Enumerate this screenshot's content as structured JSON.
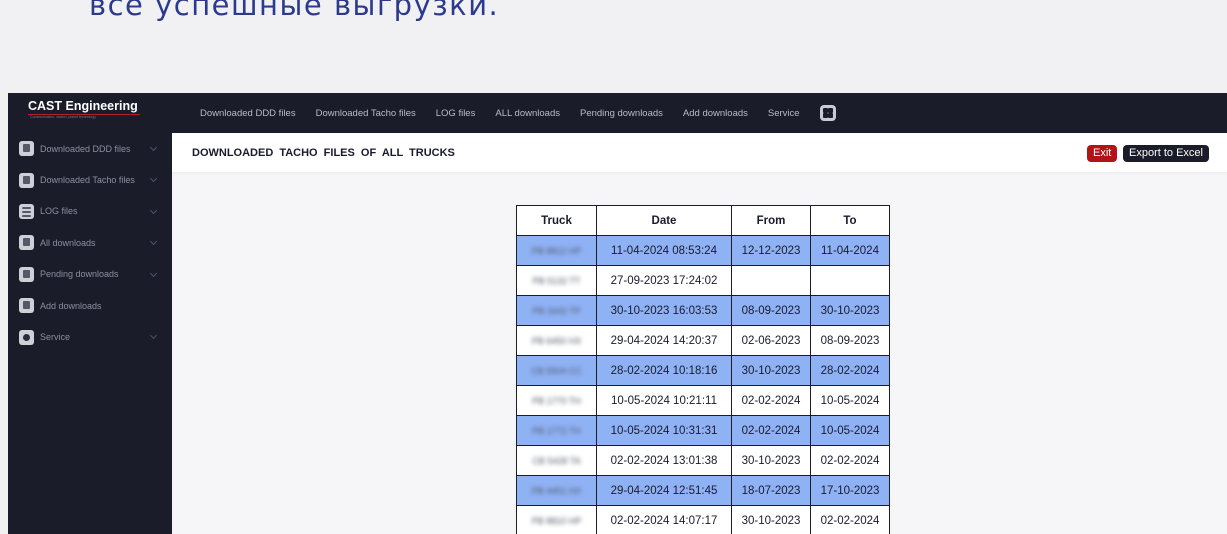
{
  "caption": "все успешные выгрузки.",
  "brand": {
    "title": "CAST Engineering",
    "subtitle": "Communication, station, planet technology"
  },
  "topnav": [
    "Downloaded DDD files",
    "Downloaded Tacho files",
    "LOG files",
    "ALL downloads",
    "Pending downloads",
    "Add downloads",
    "Service"
  ],
  "sidebar": [
    {
      "label": "Downloaded DDD files",
      "icon": "file-icon",
      "expandable": true
    },
    {
      "label": "Downloaded Tacho files",
      "icon": "file-icon",
      "expandable": true
    },
    {
      "label": "LOG files",
      "icon": "list-icon",
      "expandable": true
    },
    {
      "label": "All downloads",
      "icon": "file-icon",
      "expandable": true
    },
    {
      "label": "Pending downloads",
      "icon": "file-icon",
      "expandable": true
    },
    {
      "label": "Add downloads",
      "icon": "file-icon",
      "expandable": false
    },
    {
      "label": "Service",
      "icon": "gear-icon",
      "expandable": true
    }
  ],
  "page_title": "DOWNLOADED TACHO FILES OF ALL TRUCKS",
  "buttons": {
    "exit": "Exit",
    "export": "Export to Excel"
  },
  "table": {
    "headers": [
      "Truck",
      "Date",
      "From",
      "To"
    ],
    "rows": [
      {
        "truck": "PB 8812 HP",
        "date": "11-04-2024 08:53:24",
        "from": "12-12-2023",
        "to": "11-04-2024",
        "highlight": true
      },
      {
        "truck": "PB 5132 TT",
        "date": "27-09-2023 17:24:02",
        "from": "",
        "to": "",
        "highlight": false
      },
      {
        "truck": "PB 1642 TP",
        "date": "30-10-2023 16:03:53",
        "from": "08-09-2023",
        "to": "30-10-2023",
        "highlight": true
      },
      {
        "truck": "PB 6450 HX",
        "date": "29-04-2024 14:20:37",
        "from": "02-06-2023",
        "to": "08-09-2023",
        "highlight": false
      },
      {
        "truck": "CB 5504 CC",
        "date": "28-02-2024 10:18:16",
        "from": "30-10-2023",
        "to": "28-02-2024",
        "highlight": true
      },
      {
        "truck": "PB 1770 TH",
        "date": "10-05-2024 10:21:11",
        "from": "02-02-2024",
        "to": "10-05-2024",
        "highlight": false
      },
      {
        "truck": "PB 1772 TH",
        "date": "10-05-2024 10:31:31",
        "from": "02-02-2024",
        "to": "10-05-2024",
        "highlight": true
      },
      {
        "truck": "CB 5428 TA",
        "date": "02-02-2024 13:01:38",
        "from": "30-10-2023",
        "to": "02-02-2024",
        "highlight": false
      },
      {
        "truck": "PB 4451 HX",
        "date": "29-04-2024 12:51:45",
        "from": "18-07-2023",
        "to": "17-10-2023",
        "highlight": true
      },
      {
        "truck": "PB 8810 HP",
        "date": "02-02-2024 14:07:17",
        "from": "30-10-2023",
        "to": "02-02-2024",
        "highlight": false
      }
    ]
  },
  "colors": {
    "dark": "#1b1c2a",
    "exit": "#b31217",
    "row_highlight": "#8fb2f5"
  }
}
